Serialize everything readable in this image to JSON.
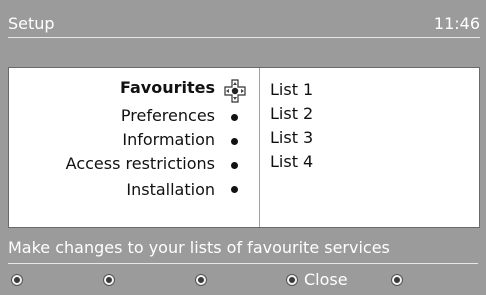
{
  "header": {
    "title": "Setup",
    "time": "11:46"
  },
  "menu": {
    "items": [
      {
        "label": "Favourites",
        "active": true
      },
      {
        "label": "Preferences",
        "active": false
      },
      {
        "label": "Information",
        "active": false
      },
      {
        "label": "Access restrictions",
        "active": false
      },
      {
        "label": "Installation",
        "active": false
      }
    ]
  },
  "lists": [
    "List 1",
    "List 2",
    "List 3",
    "List 4"
  ],
  "help_text": "Make changes to your lists of favourite services",
  "footer": {
    "close_label": "Close"
  },
  "colors": {
    "background": "#9b9b9b",
    "panel": "#ffffff",
    "text_light": "#ffffff",
    "text_dark": "#111111"
  },
  "icons": {
    "selector": "navigation-cross-icon",
    "bullet": "dot-icon",
    "remote_button": "circle-button-icon"
  }
}
